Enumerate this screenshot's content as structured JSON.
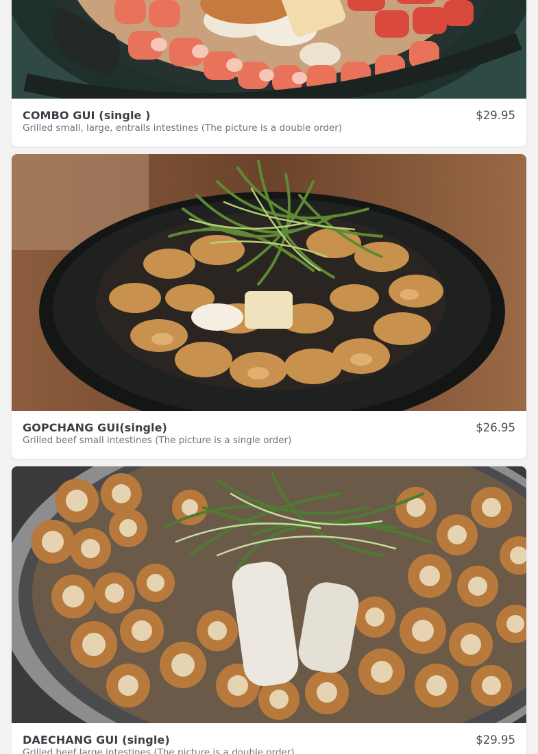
{
  "menu_items": [
    {
      "name": "COMBO GUI (single )",
      "description": "Grilled small, large, entrails intestines (The picture is a double order)",
      "price": "$29.95",
      "photo_icon": "food-photo-combo-gui"
    },
    {
      "name": "GOPCHANG GUI(single)",
      "description": "Grilled beef small intestines (The picture is a single order)",
      "price": "$26.95",
      "photo_icon": "food-photo-gopchang-gui"
    },
    {
      "name": "DAECHANG GUI (single)",
      "description": "Grilled beef large intestines (The picture is a double order)",
      "price": "$29.95",
      "photo_icon": "food-photo-daechang-gui"
    }
  ],
  "colors": {
    "page_background": "#f2f2f3",
    "card_background": "#ffffff",
    "title_text": "#3b3f45",
    "description_text": "#6e737a",
    "price_text": "#4a4e54"
  }
}
